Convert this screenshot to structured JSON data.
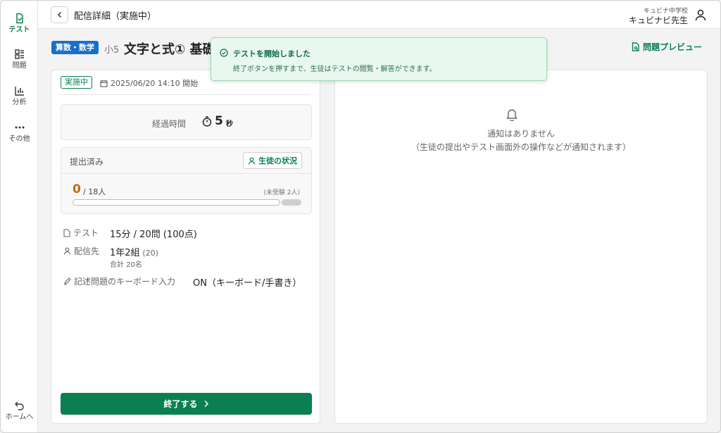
{
  "sidebar": {
    "items": [
      {
        "label": "テスト",
        "icon": "test-check-icon",
        "active": true
      },
      {
        "label": "問題",
        "icon": "questions-grid-icon"
      },
      {
        "label": "分析",
        "icon": "bar-chart-icon"
      },
      {
        "label": "その他",
        "icon": "more-dots-icon"
      }
    ],
    "home_label": "ホームへ"
  },
  "header": {
    "title": "配信詳細（実施中）",
    "school": "キュビナ中学校",
    "teacher": "キュビナビ先生"
  },
  "test": {
    "subject": "算数・数学",
    "grade": "小5",
    "title": "文字と式① 基礎"
  },
  "preview_label": "問題プレビュー",
  "status": {
    "badge": "実施中",
    "start": "2025/06/20 14:10 開始"
  },
  "elapsed": {
    "label": "経過時間",
    "value": "5",
    "unit": "秒"
  },
  "submission": {
    "label": "提出済み",
    "button": "生徒の状況",
    "count": "0",
    "total": "/ 18人",
    "absent": "(未受験 2人)",
    "progress": 0
  },
  "details": {
    "test_label": "テスト",
    "test_value": "15分 / 20問 (100点)",
    "dest_label": "配信先",
    "dest_class": "1年2組",
    "dest_count": "(20)",
    "dest_total": "合計 20名",
    "keyboard_label": "記述問題のキーボード入力",
    "keyboard_value": "ON（キーボード/手書き）"
  },
  "end_button": "終了する",
  "notifications": {
    "empty": "通知はありません",
    "hint": "（生徒の提出やテスト画面外の操作などが通知されます）"
  },
  "toast": {
    "title": "テストを開始しました",
    "message": "終了ボタンを押すまで、生徒はテストの閲覧・解答ができます。"
  },
  "colors": {
    "accent": "#0a8050",
    "subject_badge": "#1a6fc9",
    "count": "#c26a00"
  }
}
